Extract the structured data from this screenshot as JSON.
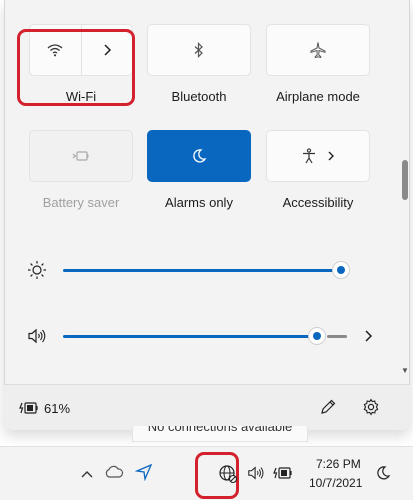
{
  "quick_settings": {
    "tiles": [
      {
        "label": "Wi-Fi",
        "icon": "wifi-icon",
        "state": "off",
        "highlighted": true
      },
      {
        "label": "Bluetooth",
        "icon": "bluetooth-icon",
        "state": "off"
      },
      {
        "label": "Airplane mode",
        "icon": "airplane-icon",
        "state": "off"
      },
      {
        "label": "Battery saver",
        "icon": "battery-saver-icon",
        "state": "disabled"
      },
      {
        "label": "Alarms only",
        "icon": "moon-icon",
        "state": "on"
      },
      {
        "label": "Accessibility",
        "icon": "accessibility-icon",
        "state": "off"
      }
    ],
    "brightness": {
      "icon": "sun-icon",
      "level_percent": 100
    },
    "volume": {
      "icon": "speaker-icon",
      "level_percent": 88
    },
    "accent_color": "#0967c0",
    "highlight_color": "#d3212d"
  },
  "footer": {
    "battery_text": "61%",
    "edit_icon": "pencil-icon",
    "settings_icon": "gear-icon"
  },
  "tooltip": {
    "text": "No connections available"
  },
  "taskbar": {
    "icons": [
      "chevron-up-icon",
      "cloud-icon",
      "location-icon",
      "globe-no-connection-icon",
      "speaker-icon",
      "battery-charging-icon",
      "moon-icon"
    ],
    "time": "7:26 PM",
    "date": "10/7/2021"
  }
}
